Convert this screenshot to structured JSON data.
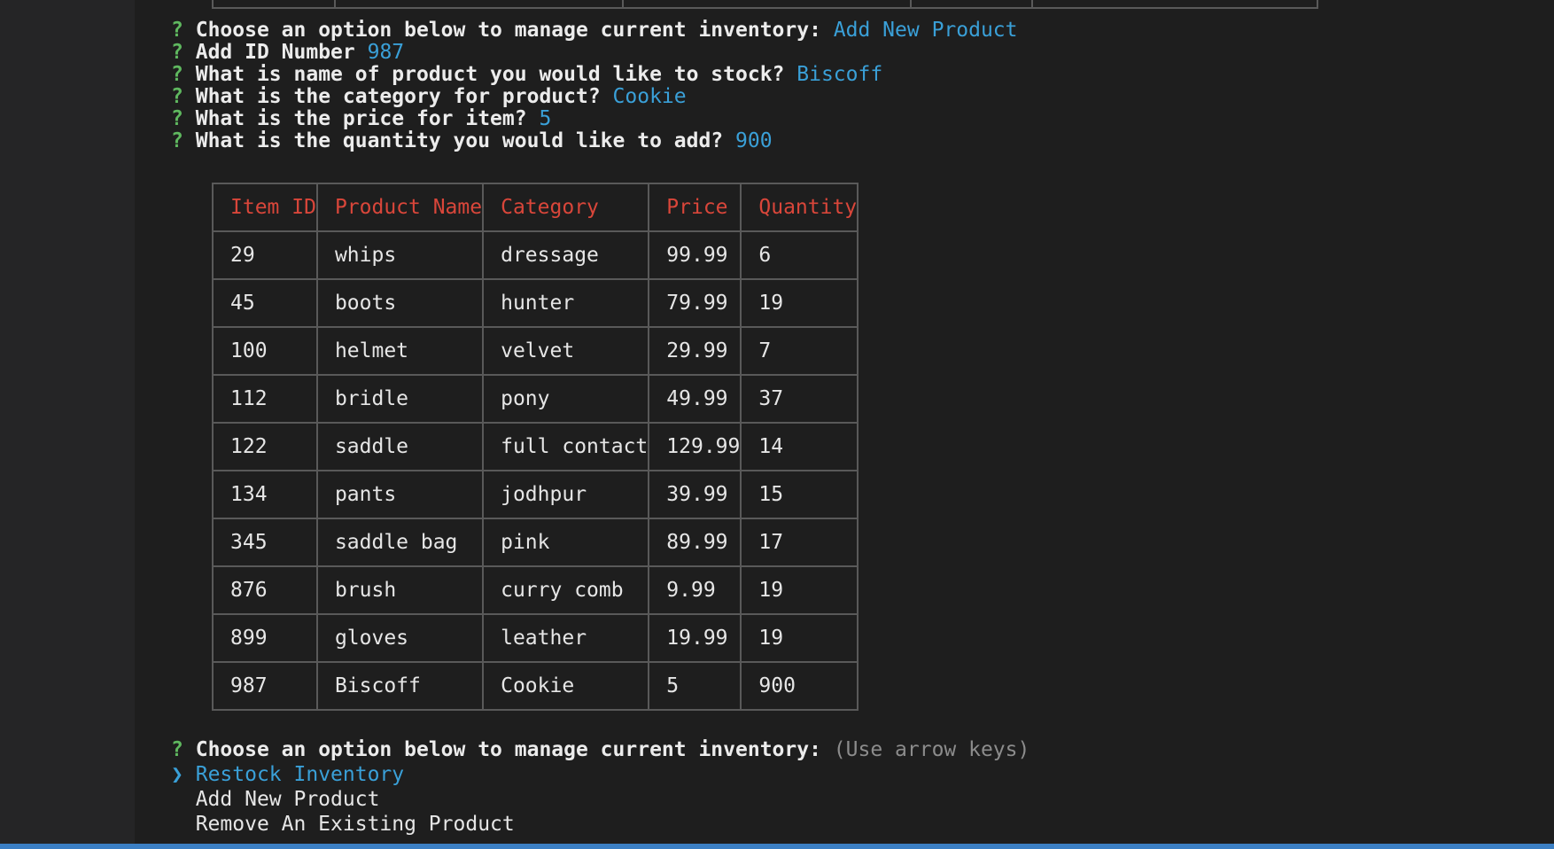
{
  "prompts": [
    {
      "mark": "?",
      "question": "Choose an option below to manage current inventory:",
      "answer": "Add New Product"
    },
    {
      "mark": "?",
      "question": "Add ID Number",
      "answer": "987"
    },
    {
      "mark": "?",
      "question": "What is name of product you would like to stock?",
      "answer": "Biscoff"
    },
    {
      "mark": "?",
      "question": "What is the category for product?",
      "answer": "Cookie"
    },
    {
      "mark": "?",
      "question": "What is the price for item?",
      "answer": "5"
    },
    {
      "mark": "?",
      "question": "What is the quantity you would like to add?",
      "answer": "900"
    }
  ],
  "table": {
    "headers": [
      "Item ID",
      "Product Name",
      "Category",
      "Price",
      "Quantity"
    ],
    "rows": [
      [
        "29",
        "whips",
        "dressage",
        "99.99",
        "6"
      ],
      [
        "45",
        "boots",
        "hunter",
        "79.99",
        "19"
      ],
      [
        "100",
        "helmet",
        "velvet",
        "29.99",
        "7"
      ],
      [
        "112",
        "bridle",
        "pony",
        "49.99",
        "37"
      ],
      [
        "122",
        "saddle",
        "full contact",
        "129.99",
        "14"
      ],
      [
        "134",
        "pants",
        "jodhpur",
        "39.99",
        "15"
      ],
      [
        "345",
        "saddle bag",
        "pink",
        "89.99",
        "17"
      ],
      [
        "876",
        "brush",
        "curry comb",
        "9.99",
        "19"
      ],
      [
        "899",
        "gloves",
        "leather",
        "19.99",
        "19"
      ],
      [
        "987",
        "Biscoff",
        "Cookie",
        "5",
        "900"
      ]
    ]
  },
  "menu": {
    "mark": "?",
    "question": "Choose an option below to manage current inventory:",
    "hint": "(Use arrow keys)",
    "pointer": "❯",
    "options": [
      "Restock Inventory",
      "Add New Product",
      "Remove An Existing Product"
    ]
  },
  "colors": {
    "prompt_mark": "#5fb85f",
    "answer": "#3aa0d8",
    "table_header": "#d9463a",
    "hint": "#8c8c8c",
    "status_bar": "#3b7fc4"
  }
}
